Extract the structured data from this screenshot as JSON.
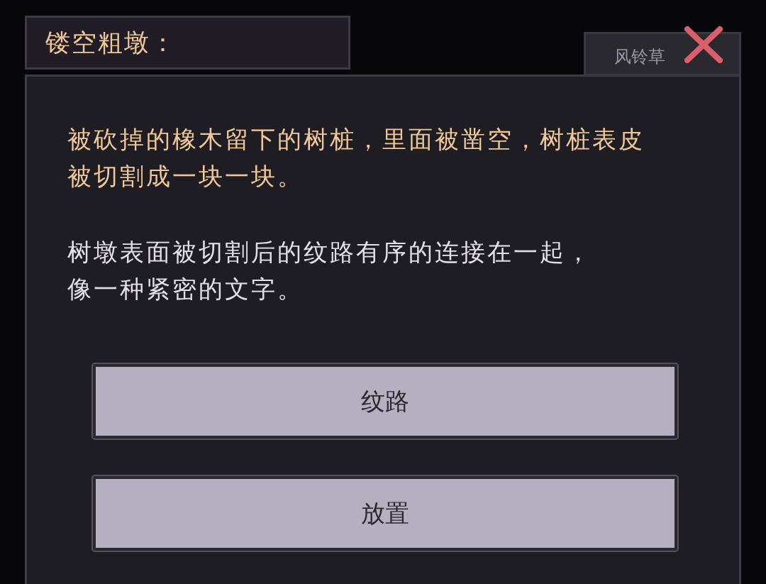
{
  "title": "镂空粗墩：",
  "side_tab": {
    "label": "风铃草"
  },
  "description": [
    {
      "kind": "flavor",
      "lines": [
        "被砍掉的橡木留下的树桩，里面被凿空，树桩表皮",
        "被切割成一块一块。"
      ]
    },
    {
      "kind": "note",
      "lines": [
        "树墩表面被切割后的纹路有序的连接在一起，",
        "像一种紧密的文字。"
      ]
    }
  ],
  "buttons": [
    "纹路",
    "放置"
  ]
}
